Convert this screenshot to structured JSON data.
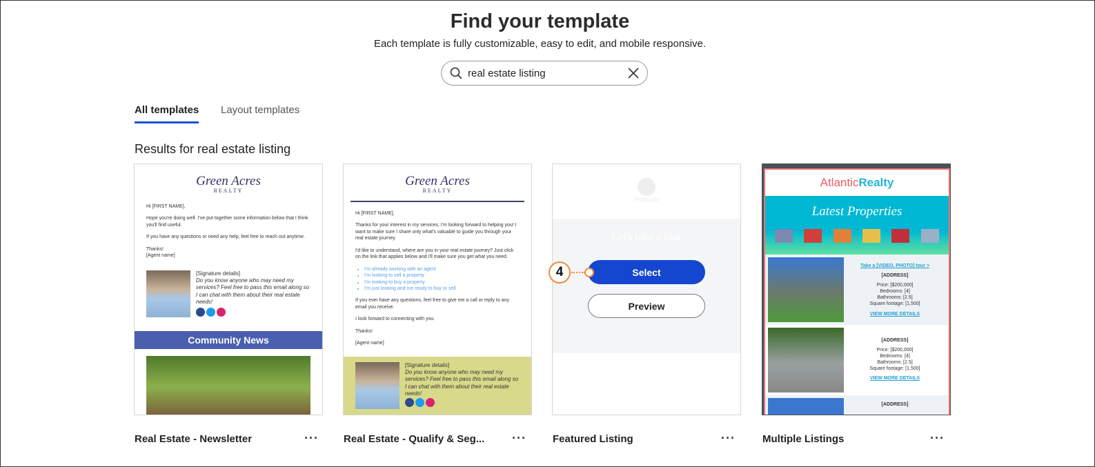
{
  "header": {
    "title": "Find your template",
    "subtitle": "Each template is fully customizable, easy to edit, and mobile responsive."
  },
  "search": {
    "value": "real estate listing",
    "placeholder": "Search"
  },
  "tabs": [
    {
      "label": "All templates",
      "active": true
    },
    {
      "label": "Layout templates",
      "active": false
    }
  ],
  "results_heading": "Results for real estate listing",
  "cards": [
    {
      "name": "Real Estate - Newsletter",
      "logo": "Green Acres",
      "logo_sub": "REALTY",
      "greeting": "Hi [FIRST NAME],",
      "body1": "Hope you're doing well. I've put together some information below that I think you'll find useful.",
      "body2": "If you have any questions or need any help, feel free to reach out anytime.",
      "thanks": "Thanks!",
      "agent": "[Agent name]",
      "sig_title": "[Signature details]",
      "sig_text": "Do you know anyone who may need my services? Feel free to pass this email along so I can chat with them about their real estate needs!",
      "banner": "Community News"
    },
    {
      "name": "Real Estate - Qualify & Seg...",
      "logo": "Green Acres",
      "logo_sub": "REALTY",
      "greeting": "Hi [FIRST NAME],",
      "body1": "Thanks for your interest in my services, I'm looking forward to helping you! I want to make sure I share only what's valuable to guide you through your real estate journey.",
      "body2": "I'd like to understand, where are you in your real estate journey? Just click on the link that applies below and I'll make sure you get what you need.",
      "links": [
        "I'm already working with an agent",
        "I'm looking to sell a property",
        "I'm looking to buy a property",
        "I'm just looking and not ready to buy or sell"
      ],
      "body3": "If you ever have any questions, feel free to give me a call or reply to any email you receive.",
      "body4": "I look forward to connecting with you.",
      "thanks": "Thanks!",
      "agent": "[Agent name]",
      "sig_title": "[Signature details]",
      "sig_text": "Do you know anyone who may need my services? Feel free to pass this email along so I can chat with them about their real estate needs!"
    },
    {
      "name": "Featured Listing",
      "faded_heading": "Let's take a tour",
      "faded_logo": "Premium",
      "select_label": "Select",
      "preview_label": "Preview",
      "step": "4"
    },
    {
      "name": "Multiple Listings",
      "logo_a": "Atlantic",
      "logo_b": "Realty",
      "banner": "Latest Properties",
      "tour_link": "Take a [VIDEO, PHOTO] tour >",
      "listing": {
        "address": "[ADDRESS]",
        "price": "Price: [$200,000]",
        "bed": "Bedrooms: [4]",
        "bath": "Bathrooms: [2.5]",
        "sqft": "Square footage: [1,500]",
        "details": "VIEW MORE DETAILS"
      }
    }
  ],
  "more_icon": "ellipsis-icon",
  "colors": {
    "accent": "#1d4ed8",
    "select": "#1446d0",
    "step": "#f5893c",
    "news_banner": "#4a5fae",
    "sig_bg": "#d8d98a",
    "atlantic_cyan": "#00b8d4"
  }
}
